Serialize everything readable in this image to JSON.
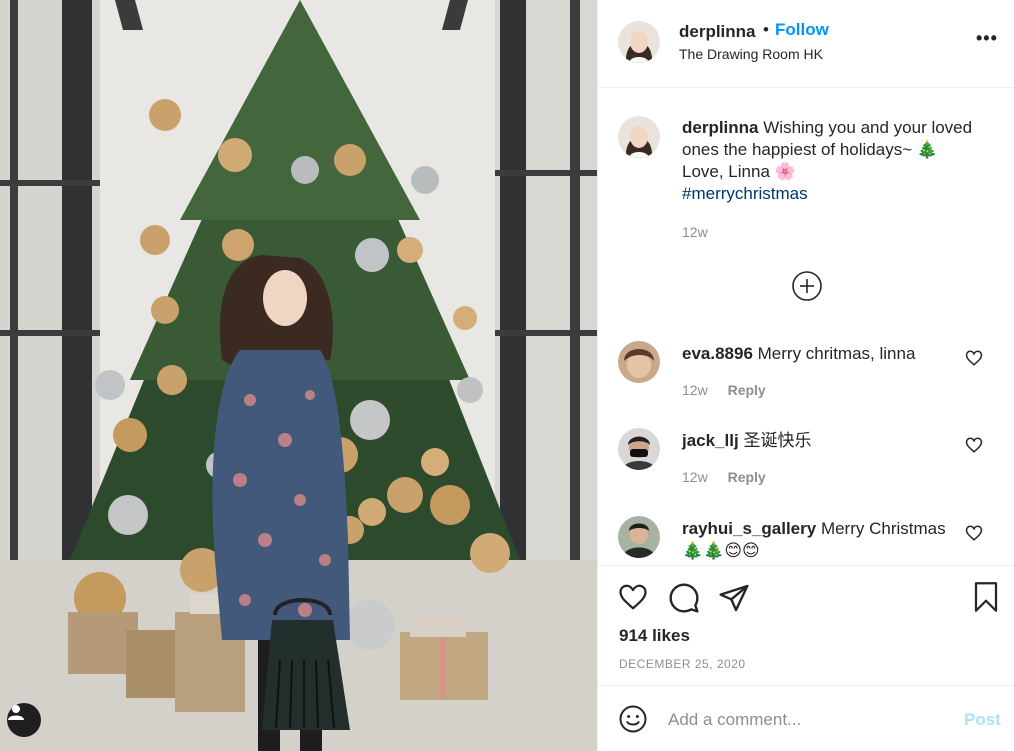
{
  "post": {
    "username": "derplinna",
    "separator": "•",
    "follow_label": "Follow",
    "location": "The Drawing Room HK",
    "more_label": "•••",
    "caption": {
      "username": "derplinna",
      "line1": "Wishing you and your loved ones the happiest of holidays~ 🎄",
      "line2": "Love, Linna 🌸",
      "hashtag": "#merrychristmas",
      "time": "12w"
    },
    "load_more_icon": "plus-circle-icon",
    "likes": "914 likes",
    "date": "DECEMBER 25, 2020"
  },
  "comments": [
    {
      "username": "eva.8896",
      "text": "Merry chritmas, linna",
      "time": "12w",
      "reply_label": "Reply"
    },
    {
      "username": "jack_llj",
      "text": "圣诞快乐",
      "time": "12w",
      "reply_label": "Reply"
    },
    {
      "username": "rayhui_s_gallery",
      "text": "Merry Christmas 🎄🎄😊😊"
    }
  ],
  "add_comment": {
    "placeholder": "Add a comment...",
    "post_label": "Post"
  },
  "colors": {
    "accent": "#0095f6",
    "hashtag": "#00376b",
    "muted": "#8e8e8e",
    "post_disabled": "#b2dffc"
  },
  "icons": {
    "like": "heart-icon",
    "comment": "comment-bubble-icon",
    "share": "paper-plane-icon",
    "save": "bookmark-icon",
    "emoji": "smiley-icon",
    "tag": "user-tag-icon"
  }
}
